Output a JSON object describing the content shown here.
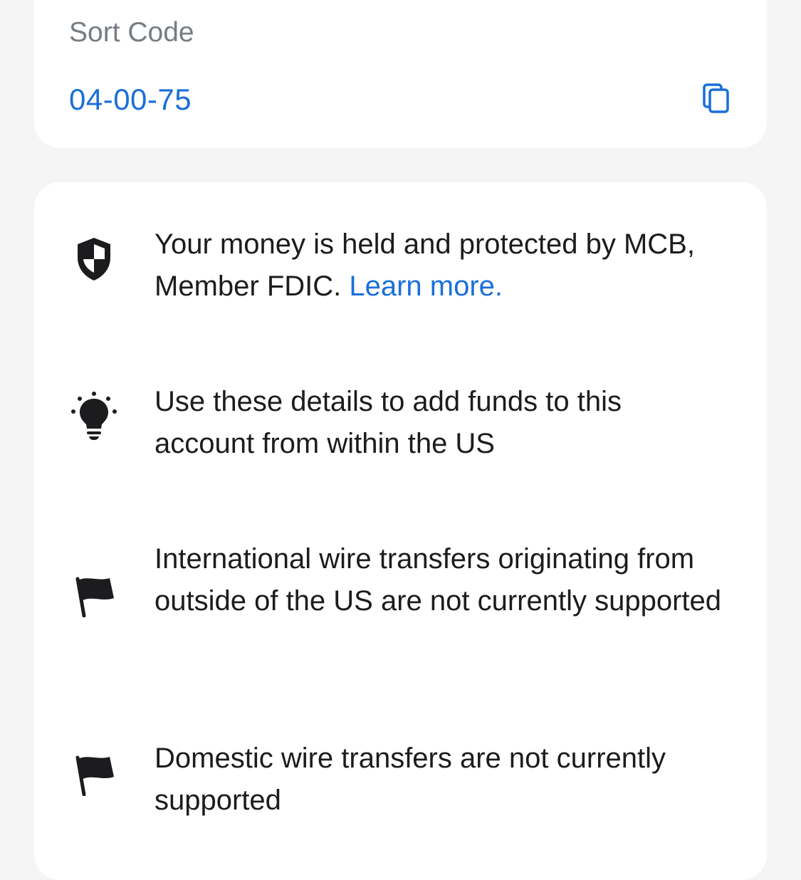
{
  "account_details": {
    "sort_code_label": "Sort Code",
    "sort_code_value": "04-00-75",
    "copy_icon": "copy-icon"
  },
  "info": {
    "protection": {
      "icon": "shield-icon",
      "text": "Your money is held and protected by MCB, Member FDIC.",
      "link_label": "Learn more."
    },
    "tip": {
      "icon": "lightbulb-icon",
      "text": "Use these details to add funds to this account from within the US"
    },
    "international": {
      "icon": "flag-icon",
      "text": "International wire transfers originating from outside of the US are not currently supported"
    },
    "domestic": {
      "icon": "flag-icon",
      "text": "Domestic wire transfers are not currently supported"
    }
  },
  "colors": {
    "accent": "#1a6fd8",
    "label_gray": "#767c84",
    "text": "#1c1c1e",
    "background": "#f5f5f5",
    "card": "#ffffff"
  }
}
